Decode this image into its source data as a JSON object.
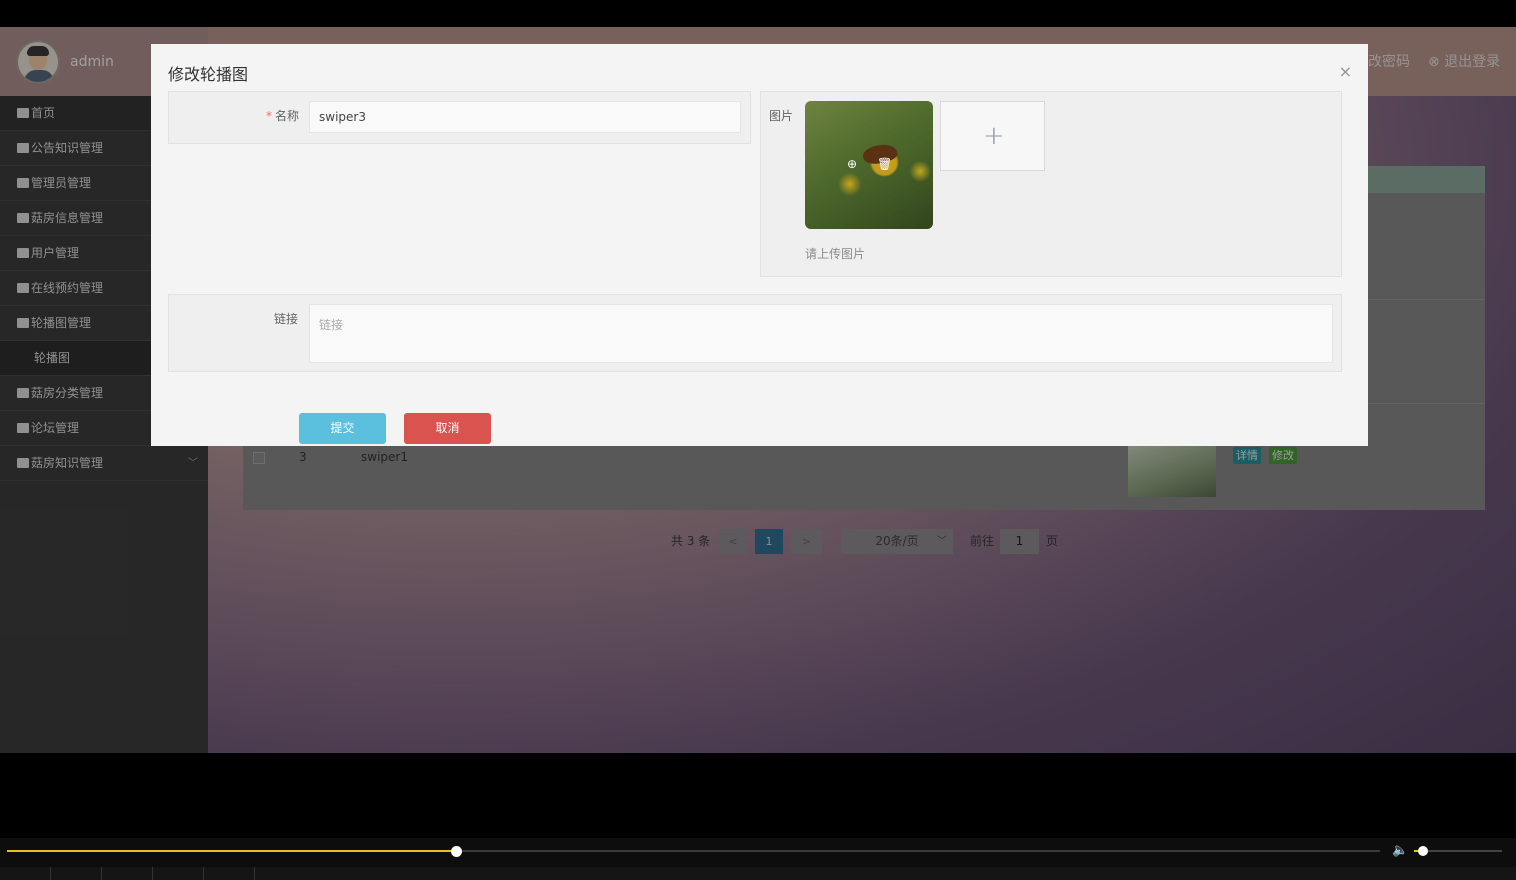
{
  "sidebar": {
    "user": "admin",
    "items": [
      {
        "label": "首页"
      },
      {
        "label": "公告知识管理"
      },
      {
        "label": "管理员管理"
      },
      {
        "label": "菇房信息管理"
      },
      {
        "label": "用户管理"
      },
      {
        "label": "在线预约管理"
      },
      {
        "label": "轮播图管理"
      },
      {
        "label": "轮播图"
      },
      {
        "label": "菇房分类管理"
      },
      {
        "label": "论坛管理"
      },
      {
        "label": "菇房知识管理"
      }
    ]
  },
  "header": {
    "change_password": "改密码",
    "logout": "退出登录"
  },
  "table": {
    "row": {
      "index": "3",
      "name": "swiper1"
    },
    "detail_label": "详情",
    "edit_label": "修改",
    "detail_color": "#2a8f9c",
    "edit_color": "#4a9a3a"
  },
  "pagination": {
    "total": "共 3 条",
    "prev": "<",
    "current": "1",
    "next": ">",
    "page_size": "20条/页",
    "goto_label": "前往",
    "goto_value": "1",
    "page_suffix": "页"
  },
  "modal": {
    "title": "修改轮播图",
    "close": "×",
    "name_label": "名称",
    "name_required": "*",
    "name_value": "swiper3",
    "image_label": "图片",
    "upload_tip": "请上传图片",
    "upload_plus": "+",
    "link_label": "链接",
    "link_placeholder": "链接",
    "submit_label": "提交",
    "cancel_label": "取消",
    "submit_color": "#5bc0de",
    "cancel_color": "#d9534f"
  },
  "player": {
    "progress": 0.327,
    "volume": 0.1
  }
}
